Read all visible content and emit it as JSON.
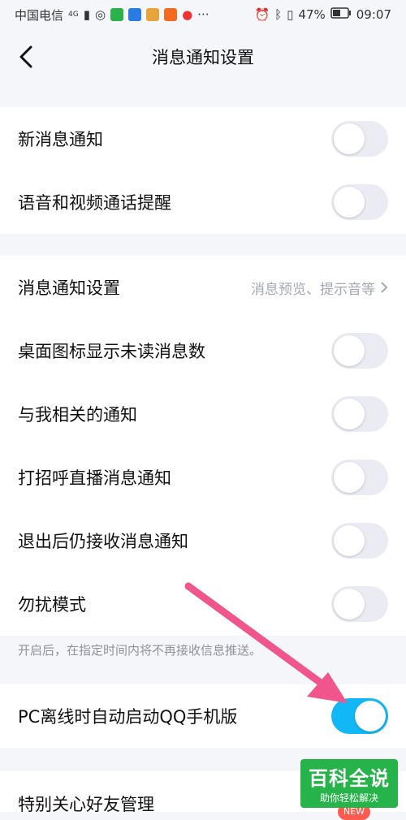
{
  "status_bar": {
    "carrier": "中国电信",
    "network": "4G",
    "battery": "47%",
    "time": "09:07"
  },
  "nav": {
    "title": "消息通知设置"
  },
  "section1": [
    {
      "label": "新消息通知",
      "on": false
    },
    {
      "label": "语音和视频通话提醒",
      "on": false
    }
  ],
  "section2": {
    "notify_settings": {
      "label": "消息通知设置",
      "value": "消息预览、提示音等"
    },
    "toggles": [
      {
        "label": "桌面图标显示未读消息数",
        "on": false
      },
      {
        "label": "与我相关的通知",
        "on": false
      },
      {
        "label": "打招呼直播消息通知",
        "on": false
      },
      {
        "label": "退出后仍接收消息通知",
        "on": false
      },
      {
        "label": "勿扰模式",
        "on": false
      }
    ]
  },
  "hint": "开启后，在指定时间内将不再接收信息推送。",
  "section3": [
    {
      "label": "PC离线时自动启动QQ手机版",
      "on": true
    }
  ],
  "section4": [
    {
      "label": "特别关心好友管理"
    }
  ],
  "badge": "NEW",
  "watermark": {
    "main": "百科全说",
    "sub": "助你轻松解决"
  },
  "colors": {
    "accent": "#12b7f5",
    "arrow": "#f0568c",
    "watermark": "#26b34a"
  }
}
